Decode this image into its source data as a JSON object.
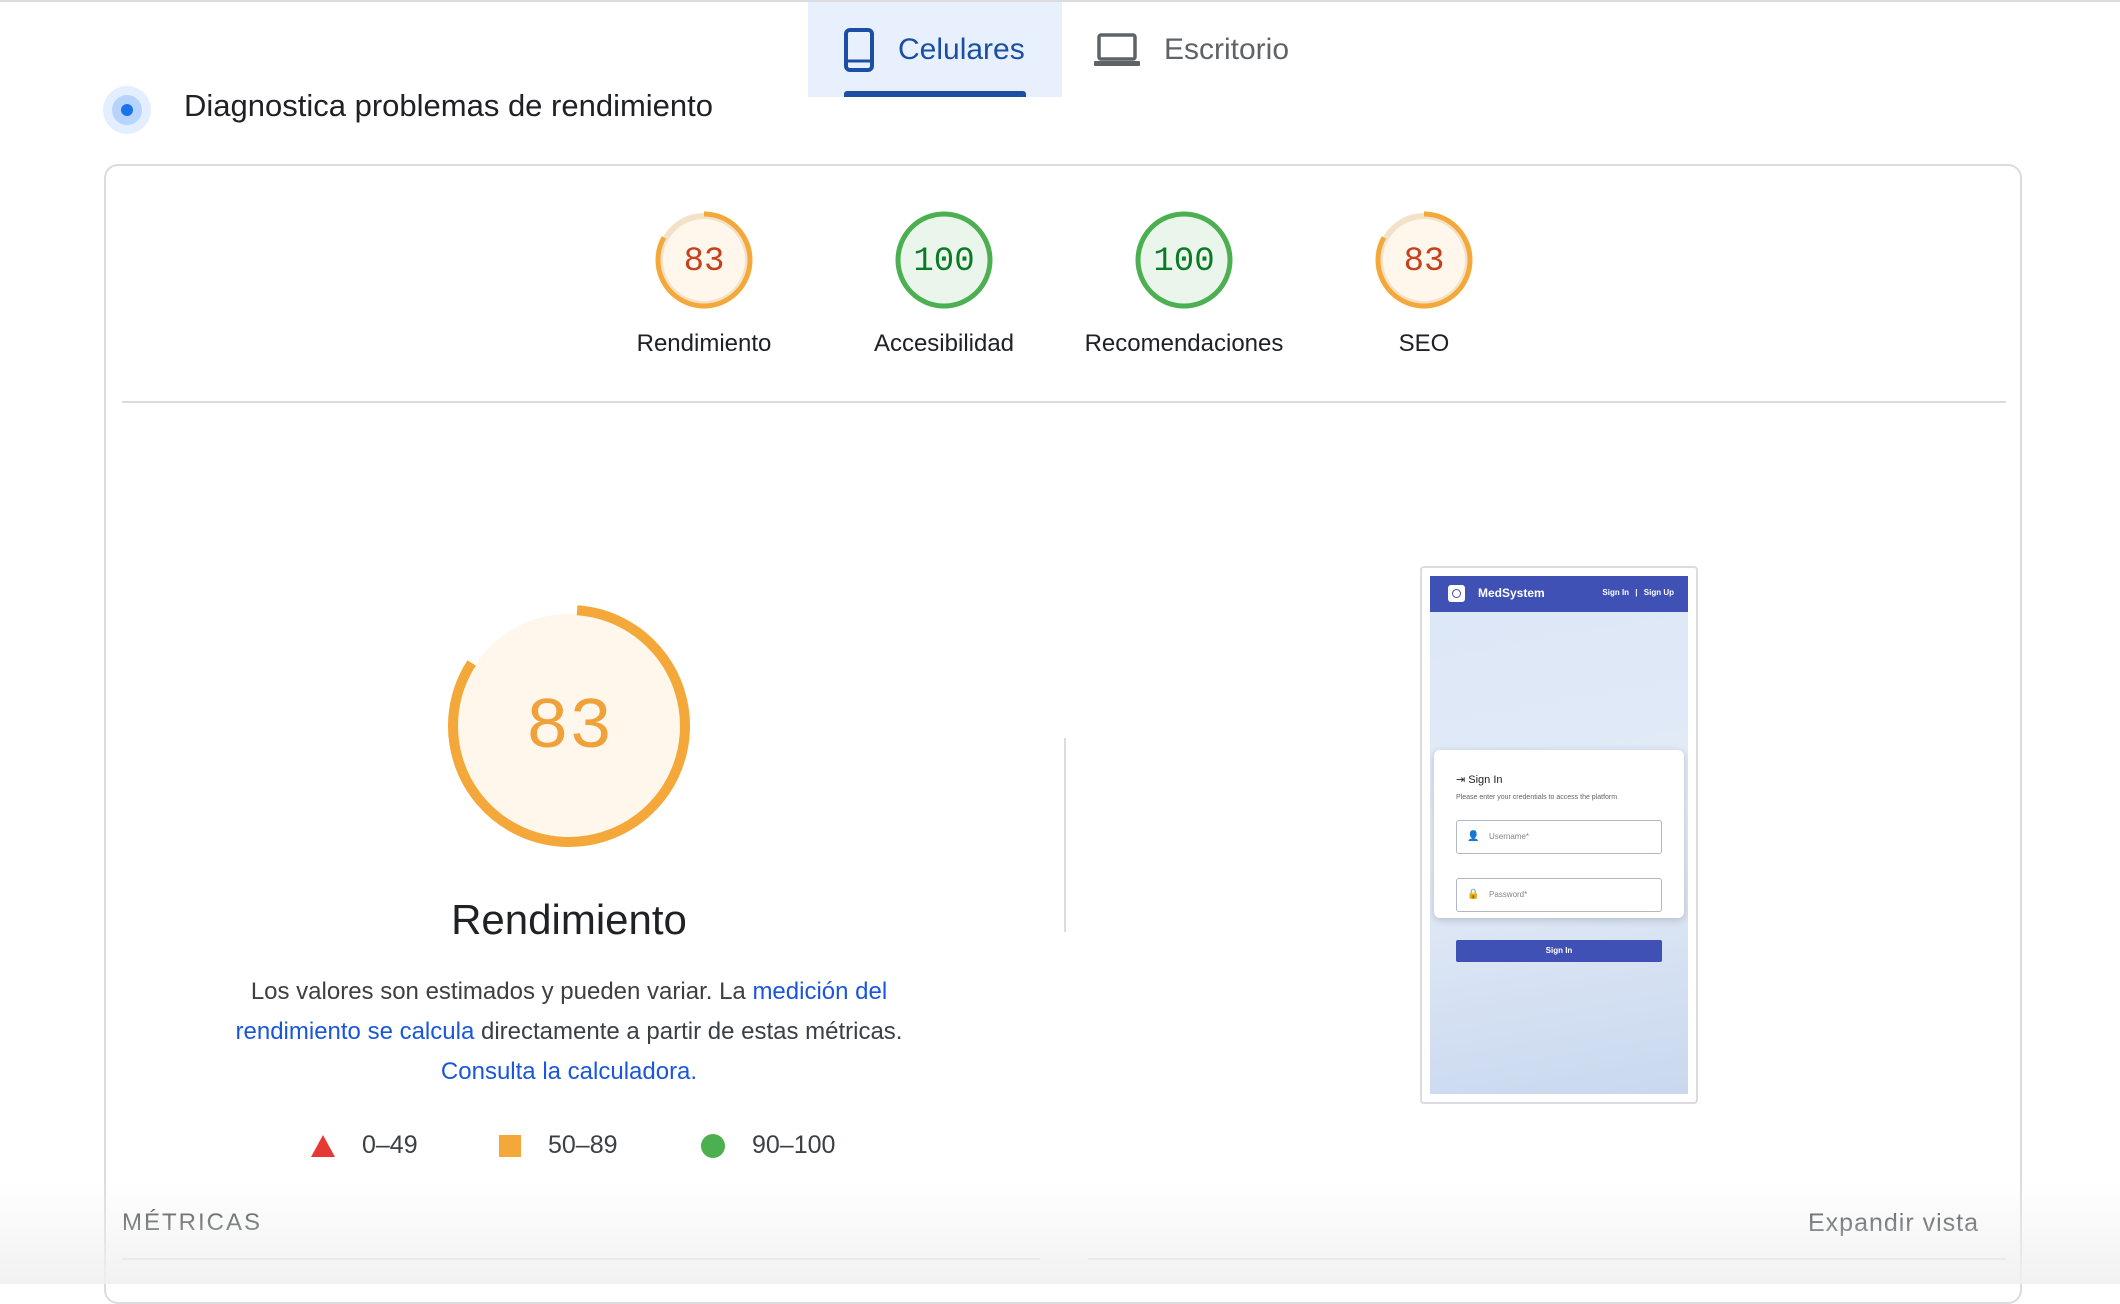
{
  "tabs": {
    "mobile_label": "Celulares",
    "desktop_label": "Escritorio",
    "active": "mobile"
  },
  "header": {
    "title": "Diagnostica problemas de rendimiento"
  },
  "scores": [
    {
      "label": "Rendimiento",
      "value": "83",
      "status": "average"
    },
    {
      "label": "Accesibilidad",
      "value": "100",
      "status": "pass"
    },
    {
      "label": "Recomendaciones",
      "value": "100",
      "status": "pass"
    },
    {
      "label": "SEO",
      "value": "83",
      "status": "average"
    }
  ],
  "performance": {
    "score": "83",
    "title": "Rendimiento",
    "desc_text_1": "Los valores son estimados y pueden variar. La ",
    "desc_link_1": "medición del rendimiento se calcula",
    "desc_text_2": " directamente a partir de estas métricas. ",
    "desc_link_2": "Consulta la calculadora."
  },
  "legend": [
    {
      "range": "0–49",
      "shape": "triangle",
      "color": "#e53935"
    },
    {
      "range": "50–89",
      "shape": "square",
      "color": "#f4a83a"
    },
    {
      "range": "90–100",
      "shape": "circle",
      "color": "#4caf50"
    }
  ],
  "metrics": {
    "label": "MÉTRICAS",
    "expand_label": "Expandir vista"
  },
  "screenshot": {
    "brand": "MedSystem",
    "nav_sign_in": "Sign In",
    "nav_sep": "|",
    "nav_sign_up": "Sign Up",
    "card_title": "Sign In",
    "card_subtitle": "Please enter your credentials to access the platform",
    "username_placeholder": "Username*",
    "password_placeholder": "Password*",
    "button_label": "Sign In"
  },
  "colors": {
    "accent": "#1a4fa3",
    "average_stroke": "#f4a83a",
    "average_text": "#c5401c",
    "average_fill": "#fff6ec",
    "pass_stroke": "#4caf50",
    "pass_text": "#0b7a25",
    "pass_fill": "#eaf6ec"
  }
}
